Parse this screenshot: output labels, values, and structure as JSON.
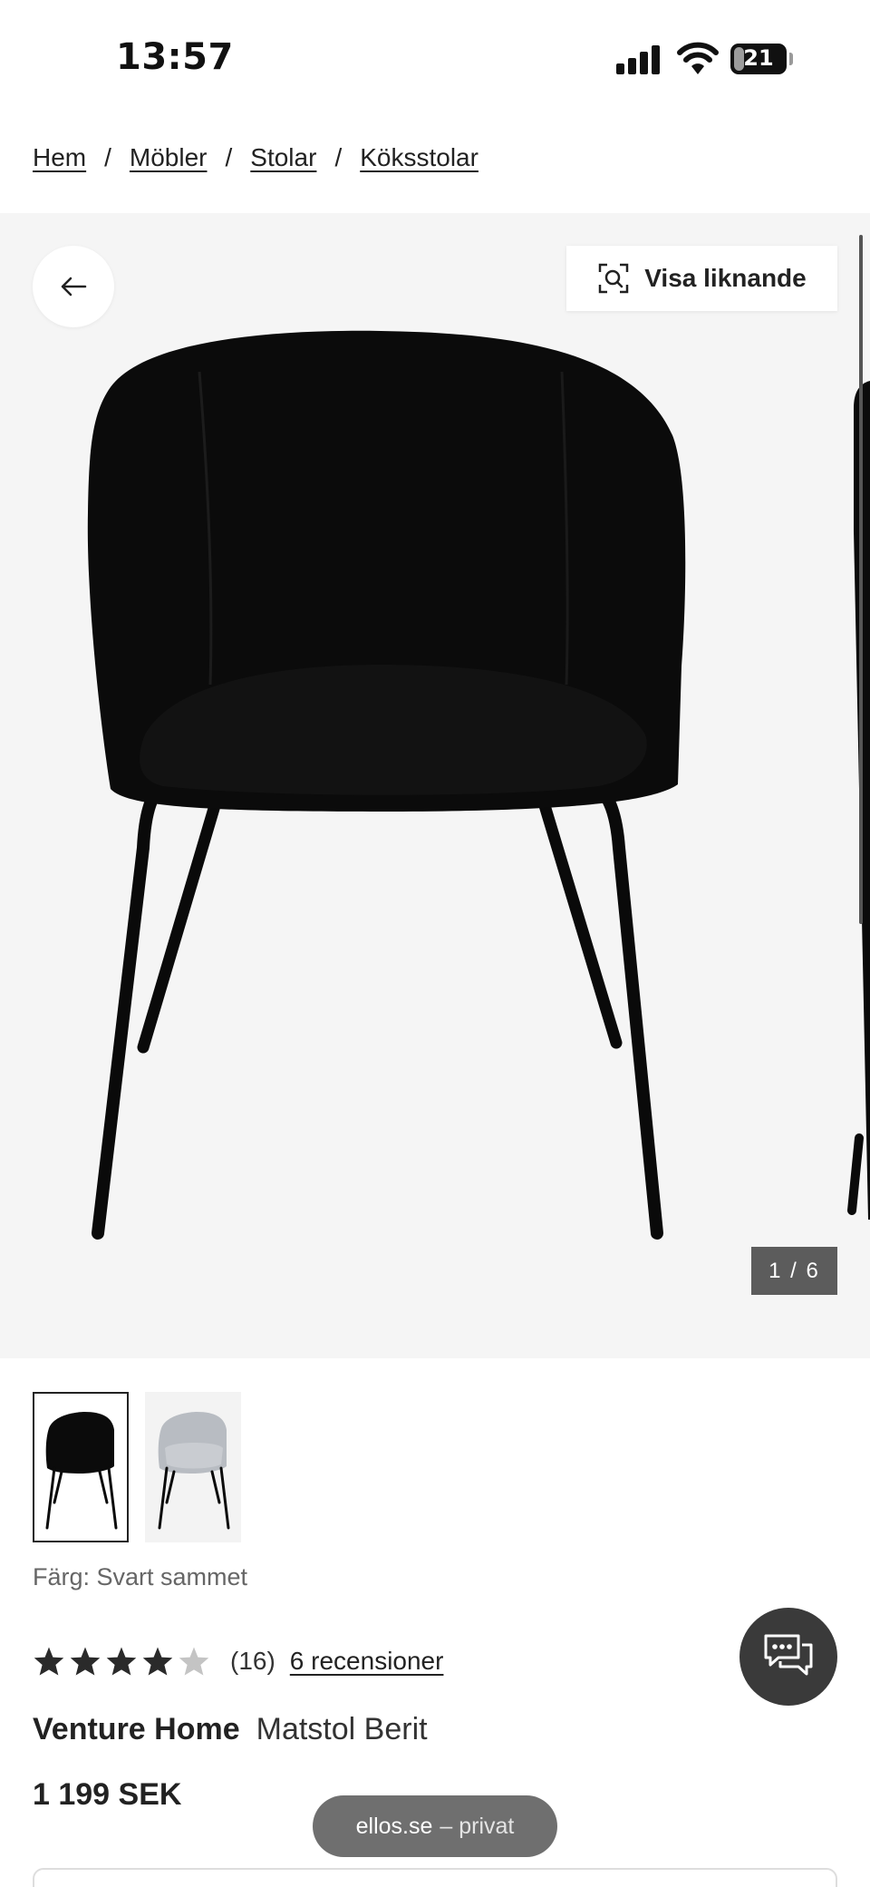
{
  "status_bar": {
    "time": "13:57",
    "battery": "21",
    "battery_level": 0.21
  },
  "breadcrumb": [
    {
      "label": "Hem"
    },
    {
      "label": "Möbler"
    },
    {
      "label": "Stolar"
    },
    {
      "label": "Köksstolar"
    }
  ],
  "breadcrumb_separator": "/",
  "gallery": {
    "similar_button_label": "Visa liknande",
    "counter": "1 / 6"
  },
  "thumbnails": [
    {
      "color": "black",
      "selected": true
    },
    {
      "color": "grey",
      "selected": false
    }
  ],
  "color_line": "Färg: Svart sammet",
  "rating": {
    "stars": 4,
    "max_stars": 5,
    "count": "(16)",
    "reviews_link": "6 recensioner"
  },
  "product": {
    "brand": "Venture Home",
    "name": "Matstol Berit",
    "price": "1 199 SEK"
  },
  "pill": {
    "domain": "ellos.se",
    "mode": "– privat"
  },
  "icons": [
    "back-arrow-icon",
    "visual-search-icon",
    "chat-icon",
    "star-icon"
  ],
  "colors": {
    "gallery_bg": "#f5f5f5",
    "chat_button": "#3a3a3a",
    "counter_bg": "#5c5c5c"
  }
}
